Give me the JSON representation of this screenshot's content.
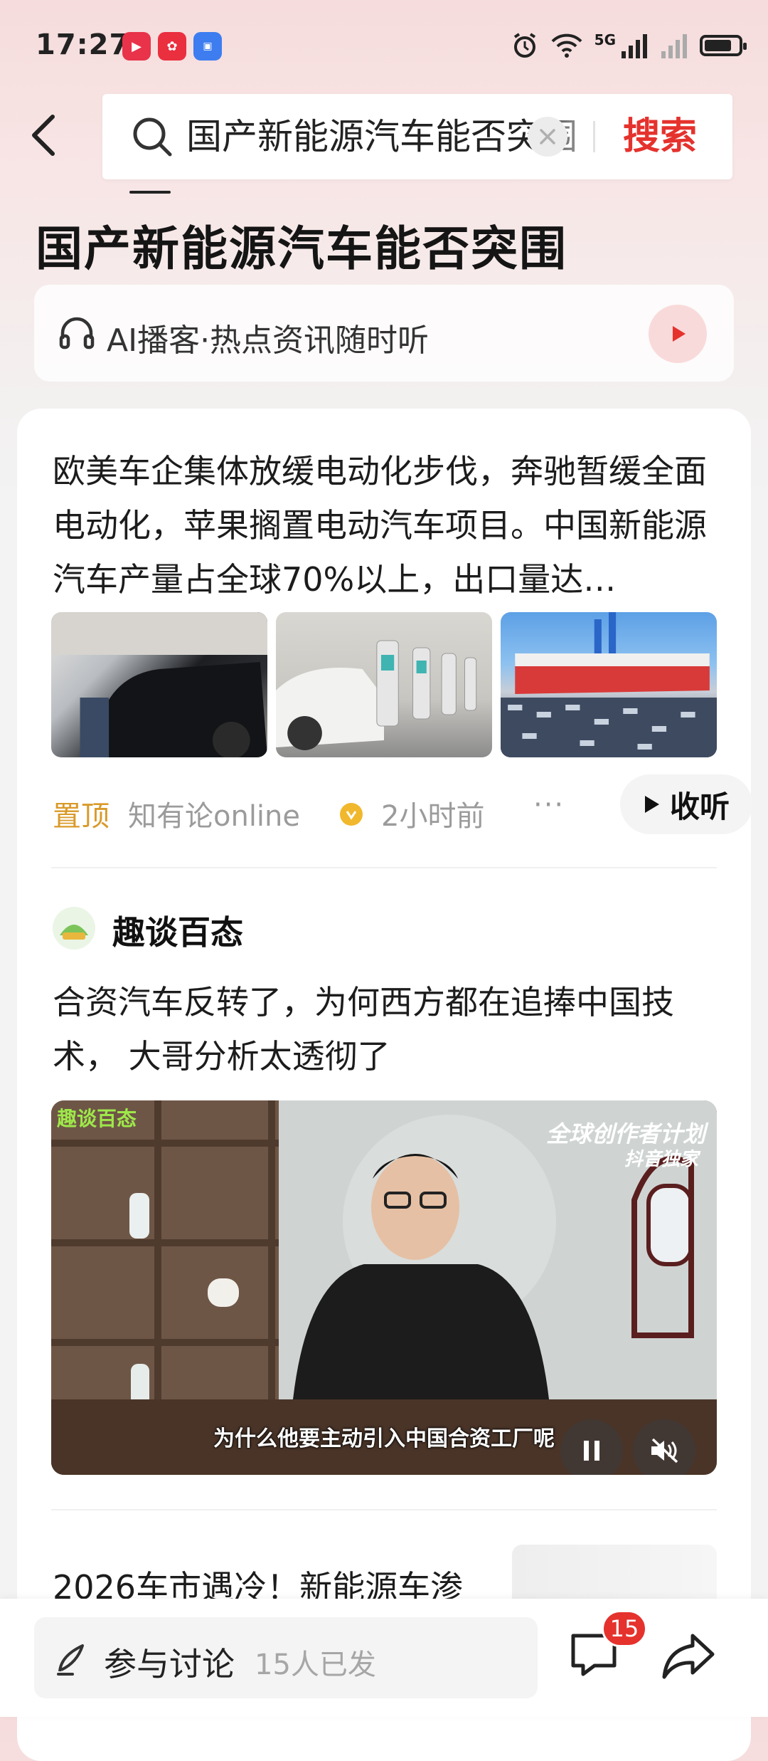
{
  "status_bar": {
    "time": "17:27",
    "network": "5G",
    "battery_level": 0.72,
    "app_icons": [
      "video-app-icon",
      "social-app-icon",
      "app-market-icon"
    ]
  },
  "search": {
    "query": "国产新能源汽车能否突围",
    "button_label": "搜索"
  },
  "page": {
    "title": "国产新能源汽车能否突围"
  },
  "ai_podcast": {
    "label": "AI播客·热点资讯随时听"
  },
  "article1": {
    "text": "欧美车企集体放缓电动化步伐，奔驰暂缓全面电动化，苹果搁置电动汽车项目。中国新能源汽车产量占全球70%以上，出口量达…",
    "pinned_label": "置顶",
    "author": "知有论online",
    "time_ago": "2小时前",
    "more_label": "···",
    "listen_label": "收听"
  },
  "article2": {
    "channel_name": "趣谈百态",
    "title": "合资汽车反转了，为何西方都在追捧中国技术， 大哥分析太透彻了",
    "video_subtitle": "为什么他要主动引入中国合资工厂呢",
    "video_tag_left": "趣谈百态",
    "video_tag_right_line1": "全球创作者计划",
    "video_tag_right_line2": "抖音独家"
  },
  "article3": {
    "title": "2026车市遇冷！新能源车渗"
  },
  "bottom_bar": {
    "discuss_label": "参与讨论",
    "discuss_count": "15人已发",
    "comment_badge": "15"
  },
  "colors": {
    "accent_red": "#e5322d",
    "pin_gold": "#d99a2a"
  }
}
